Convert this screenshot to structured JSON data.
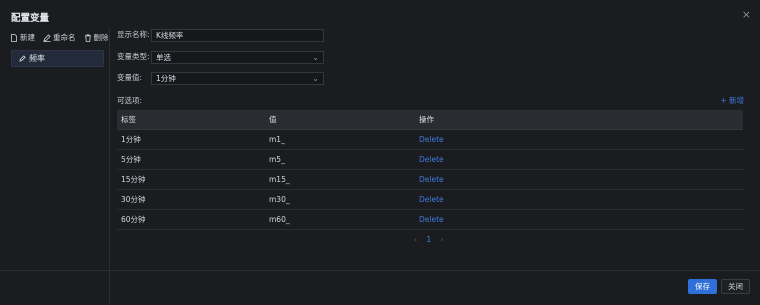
{
  "dialog": {
    "title": "配置变量",
    "close_icon": "×"
  },
  "toolbar": {
    "new_label": "新建",
    "rename_label": "重命名",
    "delete_label": "删除"
  },
  "variables": [
    {
      "label": "频率",
      "selected": true
    }
  ],
  "form": {
    "display_name_label": "显示名称:",
    "display_name_value": "K线频率",
    "var_type_label": "变量类型:",
    "var_type_value": "单选",
    "var_value_label": "变量值:",
    "var_value_value": "1分钟"
  },
  "options": {
    "label": "可选项:",
    "add_label": "+ 新增",
    "columns": [
      "标签",
      "值",
      "操作"
    ],
    "rows": [
      {
        "label": "1分钟",
        "value": "m1_",
        "action": "Delete"
      },
      {
        "label": "5分钟",
        "value": "m5_",
        "action": "Delete"
      },
      {
        "label": "15分钟",
        "value": "m15_",
        "action": "Delete"
      },
      {
        "label": "30分钟",
        "value": "m30_",
        "action": "Delete"
      },
      {
        "label": "60分钟",
        "value": "m60_",
        "action": "Delete"
      }
    ]
  },
  "pagination": {
    "prev": "‹",
    "page": "1",
    "next": "›"
  },
  "footer": {
    "save_label": "保存",
    "close_label": "关闭"
  },
  "colors": {
    "accent": "#2f6fd8",
    "link": "#3d7be0",
    "background": "#1b1c20"
  }
}
